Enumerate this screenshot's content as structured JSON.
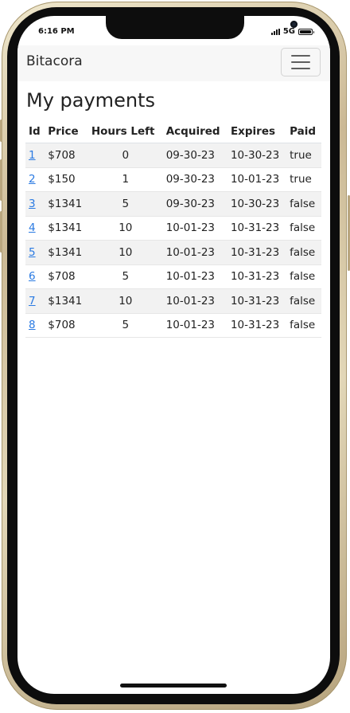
{
  "status_bar": {
    "time": "6:16 PM",
    "network": "5G"
  },
  "navbar": {
    "brand": "Bitacora",
    "menu_icon": "hamburger-icon"
  },
  "page": {
    "title": "My payments"
  },
  "table": {
    "headers": [
      "Id",
      "Price",
      "Hours Left",
      "Acquired",
      "Expires",
      "Paid"
    ],
    "rows": [
      {
        "id": "1",
        "price": "$708",
        "hours_left": "0",
        "acquired": "09-30-23",
        "expires": "10-30-23",
        "paid": "true"
      },
      {
        "id": "2",
        "price": "$150",
        "hours_left": "1",
        "acquired": "09-30-23",
        "expires": "10-01-23",
        "paid": "true"
      },
      {
        "id": "3",
        "price": "$1341",
        "hours_left": "5",
        "acquired": "09-30-23",
        "expires": "10-30-23",
        "paid": "false"
      },
      {
        "id": "4",
        "price": "$1341",
        "hours_left": "10",
        "acquired": "10-01-23",
        "expires": "10-31-23",
        "paid": "false"
      },
      {
        "id": "5",
        "price": "$1341",
        "hours_left": "10",
        "acquired": "10-01-23",
        "expires": "10-31-23",
        "paid": "false"
      },
      {
        "id": "6",
        "price": "$708",
        "hours_left": "5",
        "acquired": "10-01-23",
        "expires": "10-31-23",
        "paid": "false"
      },
      {
        "id": "7",
        "price": "$1341",
        "hours_left": "10",
        "acquired": "10-01-23",
        "expires": "10-31-23",
        "paid": "false"
      },
      {
        "id": "8",
        "price": "$708",
        "hours_left": "5",
        "acquired": "10-01-23",
        "expires": "10-31-23",
        "paid": "false"
      }
    ]
  },
  "colors": {
    "link": "#2a7ae2",
    "navbar_bg": "#f7f7f7",
    "stripe": "#f2f2f2",
    "frame_gold": "#cbb995"
  }
}
